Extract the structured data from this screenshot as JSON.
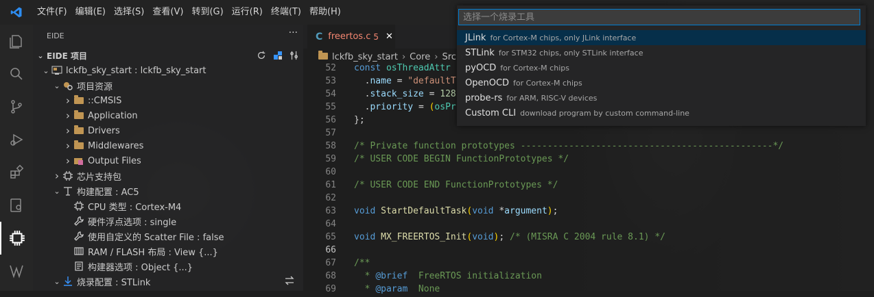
{
  "menu": [
    "文件(F)",
    "编辑(E)",
    "选择(S)",
    "查看(V)",
    "转到(G)",
    "运行(R)",
    "终端(T)",
    "帮助(H)"
  ],
  "activity_icons": [
    "explorer-icon",
    "search-icon",
    "source-control-icon",
    "run-debug-icon",
    "extensions-icon",
    "remote-icon",
    "eide-chip-icon",
    "wasm-icon"
  ],
  "sidebar": {
    "title": "EIDE",
    "more": "···",
    "section_title": "EIDE 项目",
    "tree": [
      {
        "level": 1,
        "expanded": true,
        "icon": "project-icon",
        "label": "lckfb_sky_start : lckfb_sky_start"
      },
      {
        "level": 2,
        "expanded": true,
        "icon": "resources-icon",
        "label": "项目资源"
      },
      {
        "level": 3,
        "expanded": false,
        "icon": "folder-icon",
        "label": "::CMSIS"
      },
      {
        "level": 3,
        "expanded": false,
        "icon": "folder-icon",
        "label": "Application"
      },
      {
        "level": 3,
        "expanded": false,
        "icon": "folder-icon",
        "label": "Drivers"
      },
      {
        "level": 3,
        "expanded": false,
        "icon": "folder-icon",
        "label": "Middlewares"
      },
      {
        "level": 3,
        "expanded": false,
        "icon": "output-folder-icon",
        "label": "Output Files"
      },
      {
        "level": 2,
        "expanded": false,
        "icon": "chip-icon",
        "label": "芯片支持包"
      },
      {
        "level": 2,
        "expanded": true,
        "icon": "build-config-icon",
        "label": "构建配置 : AC5"
      },
      {
        "level": 3,
        "expanded": null,
        "icon": "cpu-icon",
        "label": "CPU 类型 : Cortex-M4"
      },
      {
        "level": 3,
        "expanded": null,
        "icon": "wrench-icon",
        "label": "硬件浮点选项 : single"
      },
      {
        "level": 3,
        "expanded": null,
        "icon": "wrench-icon",
        "label": "使用自定义的 Scatter File : false"
      },
      {
        "level": 3,
        "expanded": null,
        "icon": "memory-icon",
        "label": "RAM / FLASH 布局 : View {...}"
      },
      {
        "level": 3,
        "expanded": null,
        "icon": "builder-options-icon",
        "label": "构建器选项 : Object {...}"
      },
      {
        "level": 2,
        "expanded": true,
        "icon": "flash-config-icon",
        "label": "烧录配置 : STLink"
      }
    ]
  },
  "editor": {
    "tab": {
      "icon": "C",
      "name": "freertos.c",
      "problems": "5",
      "close": "✕"
    },
    "breadcrumb": [
      "lckfb_sky_start",
      "Core",
      "Src"
    ],
    "lines": [
      {
        "n": "52",
        "html": "<span class=\"kw\">const</span> <span class=\"ty\">osThreadAttr</span>"
      },
      {
        "n": "53",
        "html": "  <span class=\"pu\">.</span><span class=\"pm\">name</span> <span class=\"pu\">=</span> <span class=\"st\">\"defaultT</span>"
      },
      {
        "n": "54",
        "html": "  <span class=\"pu\">.</span><span class=\"pm\">stack_size</span> <span class=\"pu\">=</span> <span class=\"nm\">128</span>"
      },
      {
        "n": "55",
        "html": "  <span class=\"pu\">.</span><span class=\"pm\">priority</span> <span class=\"pu\">=</span> <span class=\"br\">(</span><span class=\"ty\">osPr</span>"
      },
      {
        "n": "56",
        "html": "<span class=\"pu\">};</span>"
      },
      {
        "n": "57",
        "html": ""
      },
      {
        "n": "58",
        "html": "<span class=\"cm\">/* Private function prototypes -----------------------------------------------*/</span>"
      },
      {
        "n": "59",
        "html": "<span class=\"cm\">/* USER CODE BEGIN FunctionPrototypes */</span>"
      },
      {
        "n": "60",
        "html": ""
      },
      {
        "n": "61",
        "html": "<span class=\"cm\">/* USER CODE END FunctionPrototypes */</span>"
      },
      {
        "n": "62",
        "html": ""
      },
      {
        "n": "63",
        "html": "<span class=\"kw\">void</span> <span class=\"fn\">StartDefaultTask</span><span class=\"br\">(</span><span class=\"kw\">void</span> <span class=\"pu\">*</span><span class=\"pm\">argument</span><span class=\"br\">)</span><span class=\"pu\">;</span>"
      },
      {
        "n": "64",
        "html": ""
      },
      {
        "n": "65",
        "html": "<span class=\"kw\">void</span> <span class=\"fn\">MX_FREERTOS_Init</span><span class=\"br\">(</span><span class=\"kw\">void</span><span class=\"br\">)</span><span class=\"pu\">;</span> <span class=\"cm\">/* (MISRA C 2004 rule 8.1) */</span>"
      },
      {
        "n": "66",
        "html": ""
      },
      {
        "n": "67",
        "html": "<span class=\"cm\">/**</span>"
      },
      {
        "n": "68",
        "html": "<span class=\"cm\">  * </span><span class=\"dc\">@brief</span><span class=\"cm\">  FreeRTOS initialization</span>"
      },
      {
        "n": "69",
        "html": "<span class=\"cm\">  * </span><span class=\"dc\">@param</span><span class=\"cm\">  None</span>"
      }
    ],
    "current_line": "66"
  },
  "quickpick": {
    "placeholder": "选择一个烧录工具",
    "items": [
      {
        "label": "JLink",
        "desc": "for Cortex-M chips, only JLink interface",
        "selected": true
      },
      {
        "label": "STLink",
        "desc": "for STM32 chips, only STLink interface",
        "selected": false
      },
      {
        "label": "pyOCD",
        "desc": "for Cortex-M chips",
        "selected": false
      },
      {
        "label": "OpenOCD",
        "desc": "for Cortex-M chips",
        "selected": false
      },
      {
        "label": "probe-rs",
        "desc": "for ARM, RISC-V devices",
        "selected": false
      },
      {
        "label": "Custom CLI",
        "desc": "download program by custom command-line",
        "selected": false
      }
    ]
  },
  "colors": {
    "accent": "#007fd4",
    "selection": "#062f4a",
    "folder": "#c09553",
    "error": "#f48771"
  }
}
